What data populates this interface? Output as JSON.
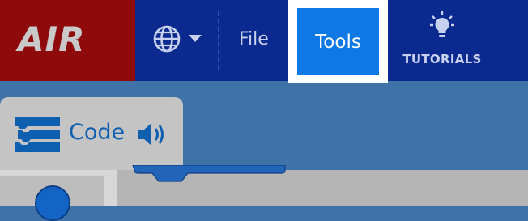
{
  "menubar": {
    "logo_text": "AIR",
    "language_icon": "globe-icon",
    "file_label": "File",
    "tools_label": "Tools",
    "tutorials_label": "TUTORIALS",
    "tutorials_icon": "lightbulb-icon"
  },
  "code_tab": {
    "label": "Code",
    "icon": "code-blocks-icon",
    "speaker_icon": "speaker-icon"
  },
  "colors": {
    "menubar": "#0b2a8f",
    "logo_bg": "#8f0a0a",
    "tools_active": "#0d78e6",
    "workspace": "#3f72a6",
    "code_accent": "#0f5fb0"
  }
}
